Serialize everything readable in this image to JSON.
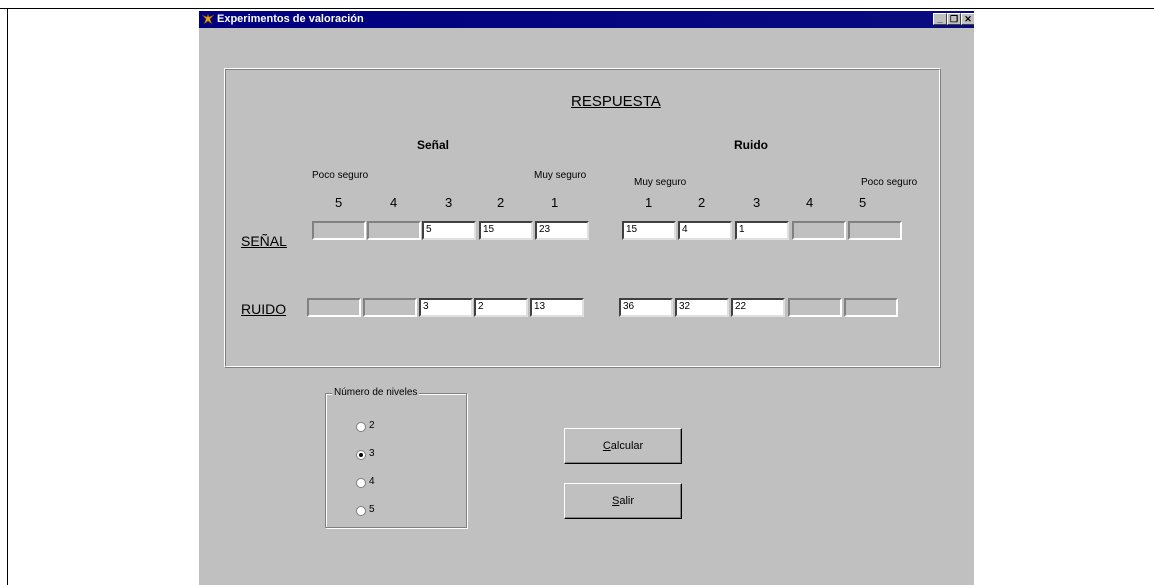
{
  "window": {
    "title": "Experimentos de valoración"
  },
  "titlebar_buttons": {
    "minimize": "_",
    "restore": "❐",
    "close": "✕"
  },
  "panel": {
    "heading": "RESPUESTA",
    "senal_header": "Señal",
    "ruido_header": "Ruido",
    "poco_seguro": "Poco seguro",
    "muy_seguro": "Muy seguro",
    "left_levels": [
      "5",
      "4",
      "3",
      "2",
      "1"
    ],
    "right_levels": [
      "1",
      "2",
      "3",
      "4",
      "5"
    ],
    "row_senal": "SEÑAL",
    "row_ruido": "RUIDO",
    "senal_left": [
      "",
      "",
      "5",
      "15",
      "23"
    ],
    "senal_right": [
      "15",
      "4",
      "1",
      "",
      ""
    ],
    "ruido_left": [
      "",
      "",
      "3",
      "2",
      "13"
    ],
    "ruido_right": [
      "36",
      "32",
      "22",
      "",
      ""
    ]
  },
  "niveles": {
    "title": "Número de niveles",
    "options": [
      "2",
      "3",
      "4",
      "5"
    ],
    "selected": "3"
  },
  "buttons": {
    "calcular_mnemonic": "C",
    "calcular_rest": "alcular",
    "salir_mnemonic": "S",
    "salir_rest": "alir"
  }
}
